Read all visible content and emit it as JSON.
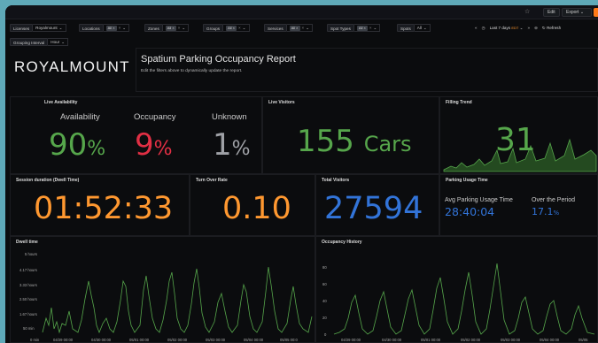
{
  "topbar": {
    "edit": "Edit",
    "export": "Export ⌄"
  },
  "filters": {
    "licenses": {
      "label": "Licenses",
      "value": "Royalmount"
    },
    "locations": {
      "label": "Locations",
      "chip": "All ×"
    },
    "zones": {
      "label": "Zones",
      "chip": "All ×"
    },
    "groups": {
      "label": "Groups",
      "chip": "All ×"
    },
    "services": {
      "label": "Services",
      "chip": "All ×"
    },
    "spot_types": {
      "label": "Spot Types",
      "chip": "All ×"
    },
    "spots": {
      "label": "Spots",
      "value": "All"
    },
    "grouping": {
      "label": "Grouping Interval",
      "value": "Hour"
    }
  },
  "time": {
    "range": "Last 7 days",
    "tz": "EDT",
    "refresh": "Refresh"
  },
  "brand": {
    "logo": "ROYALMOUNT",
    "title": "Spatium Parking Occupancy Report",
    "subtitle": "Edit the filters above to dynamically update the report."
  },
  "live_availability": {
    "title": "Live Availability",
    "availability_label": "Availability",
    "availability": "90",
    "occupancy_label": "Occupancy",
    "occupancy": "9",
    "unknown_label": "Unknown",
    "unknown": "1",
    "unit": "%"
  },
  "live_visitors": {
    "title": "Live Visitors",
    "value": "155",
    "unit": "Cars"
  },
  "filling_trend": {
    "title": "Filling Trend",
    "value": "31"
  },
  "session": {
    "title": "Session duration (Dwell Time)",
    "value": "01:52:33"
  },
  "turnover": {
    "title": "Turn Over Rate",
    "value": "0.10"
  },
  "total_visitors": {
    "title": "Total Visitors",
    "value": "27594"
  },
  "parking_usage": {
    "title": "Parking Usage Time",
    "avg_label": "Avg Parking Usage Time",
    "avg": "28:40:04",
    "period_label": "Over the Period",
    "period": "17.1",
    "unit": "%"
  },
  "dwell": {
    "title": "Dwell time",
    "yticks": [
      "5 hours",
      "4.17 hours",
      "3.33 hours",
      "2.50 hours",
      "1.67 hours",
      "50 min",
      "0 min"
    ],
    "xticks": [
      "04/29 00:00",
      "04/30 00:00",
      "05/01 00:00",
      "05/02 00:00",
      "05/03 00:00",
      "05/04 00:00",
      "05/05 00:0"
    ]
  },
  "occupancy_history": {
    "title": "Occupancy History",
    "yticks": [
      "80",
      "60",
      "40",
      "20",
      "0"
    ],
    "xticks": [
      "04/29 00:00",
      "04/30 00:00",
      "05/01 00:00",
      "05/02 00:00",
      "05/03 00:00",
      "05/04 00:00",
      "05/05"
    ]
  }
}
